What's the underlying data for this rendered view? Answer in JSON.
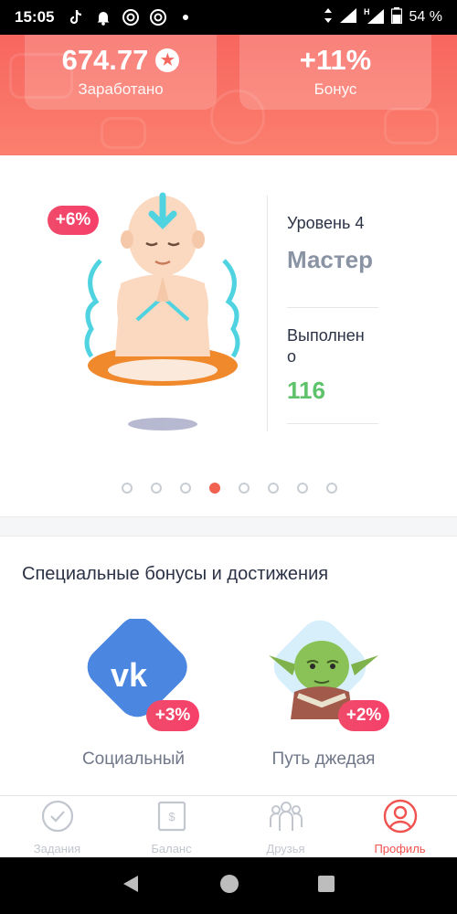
{
  "status_bar": {
    "time": "15:05",
    "battery": "54 %",
    "icons": [
      "tiktok-icon",
      "bell-icon",
      "chrome-icon",
      "chrome-icon",
      "dot-icon",
      "data-arrows-icon",
      "signal-icon",
      "h-signal-icon",
      "battery-icon"
    ]
  },
  "header": {
    "earned_value": "674.77",
    "earned_label": "Заработано",
    "bonus_value": "+11%",
    "bonus_label": "Бонус",
    "bg_color": "#f7665f"
  },
  "level_card": {
    "badge": "+6%",
    "level_label": "Уровень 4",
    "level_name": "Мастер",
    "completed_label": "Выполнен\nо",
    "completed_value": "116",
    "dots_total": 8,
    "dots_active_index": 3
  },
  "bonuses": {
    "title": "Специальные бонусы и достижения",
    "items": [
      {
        "icon": "vk-icon",
        "badge": "+3%",
        "label": "Социальный"
      },
      {
        "icon": "yoda-icon",
        "badge": "+2%",
        "label": "Путь джедая"
      }
    ]
  },
  "tabbar": {
    "items": [
      {
        "icon": "check-circle-icon",
        "label": "Задания",
        "active": false
      },
      {
        "icon": "balance-icon",
        "label": "Баланс",
        "active": false
      },
      {
        "icon": "friends-icon",
        "label": "Друзья",
        "active": false
      },
      {
        "icon": "profile-icon",
        "label": "Профиль",
        "active": true
      }
    ],
    "active_color": "#f0524f"
  },
  "navbar": {
    "icons": [
      "back-icon",
      "home-icon",
      "recents-icon"
    ]
  }
}
